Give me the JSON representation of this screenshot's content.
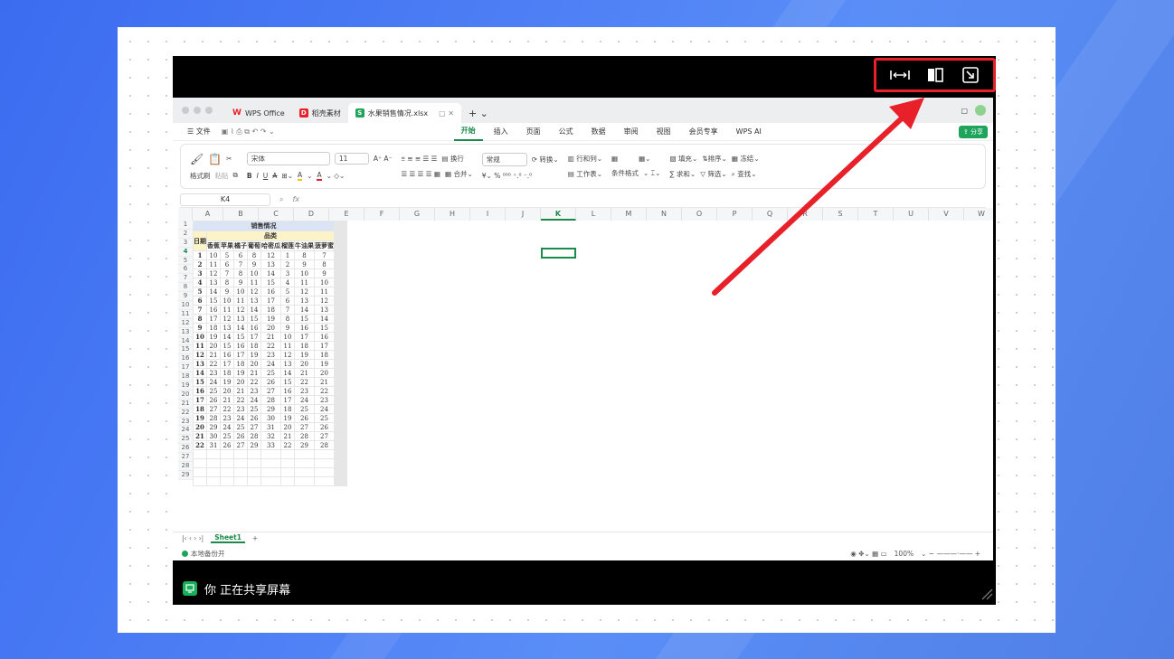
{
  "share_bar": {
    "footer_text": "你 正在共享屏幕",
    "controls": [
      "fit-width",
      "split-view",
      "exit-fullscreen"
    ]
  },
  "wps": {
    "tabs": [
      {
        "label": "WPS Office",
        "icon": "W",
        "color": "#e8202a"
      },
      {
        "label": "稻壳素材",
        "icon": "D",
        "color": "#e8202a"
      },
      {
        "label": "水果销售情况.xlsx",
        "icon": "S",
        "color": "#1fa55b"
      }
    ],
    "menu": {
      "file": "文件",
      "items": [
        "开始",
        "插入",
        "页面",
        "公式",
        "数据",
        "审阅",
        "视图",
        "会员专享",
        "WPS AI"
      ],
      "share": "分享"
    },
    "ribbon": {
      "format_painter": "格式刷",
      "paste": "粘贴",
      "font": "宋体",
      "font_size": "11",
      "wrap": "换行",
      "merge": "合并",
      "number_format": "常规",
      "convert": "转换",
      "row_col": "行和列",
      "worksheet": "工作表",
      "cond_format": "条件格式",
      "fill": "填充",
      "sort": "排序",
      "freeze": "冻结",
      "sum": "求和",
      "filter": "筛选",
      "find": "查找"
    },
    "formula_bar": {
      "cell_ref": "K4",
      "fx": "fx"
    },
    "columns": [
      "A",
      "B",
      "C",
      "D",
      "E",
      "F",
      "G",
      "H",
      "I",
      "J",
      "K",
      "L",
      "M",
      "N",
      "O",
      "P",
      "Q",
      "R",
      "S",
      "T",
      "U",
      "V",
      "W"
    ],
    "sheet": {
      "title": "销售情况",
      "category_header": "品类",
      "date_header": "日期",
      "fruits": [
        "香蕉",
        "苹果",
        "橘子",
        "葡萄",
        "哈密瓜",
        "榴莲",
        "牛油果",
        "菠萝蜜"
      ],
      "rows": [
        [
          1,
          10,
          5,
          6,
          8,
          12,
          1,
          8,
          7
        ],
        [
          2,
          11,
          6,
          7,
          9,
          13,
          2,
          9,
          8
        ],
        [
          3,
          12,
          7,
          8,
          10,
          14,
          3,
          10,
          9
        ],
        [
          4,
          13,
          8,
          9,
          11,
          15,
          4,
          11,
          10
        ],
        [
          5,
          14,
          9,
          10,
          12,
          16,
          5,
          12,
          11
        ],
        [
          6,
          15,
          10,
          11,
          13,
          17,
          6,
          13,
          12
        ],
        [
          7,
          16,
          11,
          12,
          14,
          18,
          7,
          14,
          13
        ],
        [
          8,
          17,
          12,
          13,
          15,
          19,
          8,
          15,
          14
        ],
        [
          9,
          18,
          13,
          14,
          16,
          20,
          9,
          16,
          15
        ],
        [
          10,
          19,
          14,
          15,
          17,
          21,
          10,
          17,
          16
        ],
        [
          11,
          20,
          15,
          16,
          18,
          22,
          11,
          18,
          17
        ],
        [
          12,
          21,
          16,
          17,
          19,
          23,
          12,
          19,
          18
        ],
        [
          13,
          22,
          17,
          18,
          20,
          24,
          13,
          20,
          19
        ],
        [
          14,
          23,
          18,
          19,
          21,
          25,
          14,
          21,
          20
        ],
        [
          15,
          24,
          19,
          20,
          22,
          26,
          15,
          22,
          21
        ],
        [
          16,
          25,
          20,
          21,
          23,
          27,
          16,
          23,
          22
        ],
        [
          17,
          26,
          21,
          22,
          24,
          28,
          17,
          24,
          23
        ],
        [
          18,
          27,
          22,
          23,
          25,
          29,
          18,
          25,
          24
        ],
        [
          19,
          28,
          23,
          24,
          26,
          30,
          19,
          26,
          25
        ],
        [
          20,
          29,
          24,
          25,
          27,
          31,
          20,
          27,
          26
        ],
        [
          21,
          30,
          25,
          26,
          28,
          32,
          21,
          28,
          27
        ],
        [
          22,
          31,
          26,
          27,
          29,
          33,
          22,
          29,
          28
        ]
      ]
    },
    "sheet_tab": "Sheet1",
    "status": {
      "backup": "本地备份开",
      "zoom": "100%"
    }
  },
  "colors": {
    "annotation": "#e8202a",
    "accent": "#1b8a4a",
    "title_fill": "#dbe4f4",
    "header_fill": "#fdf3c8"
  }
}
